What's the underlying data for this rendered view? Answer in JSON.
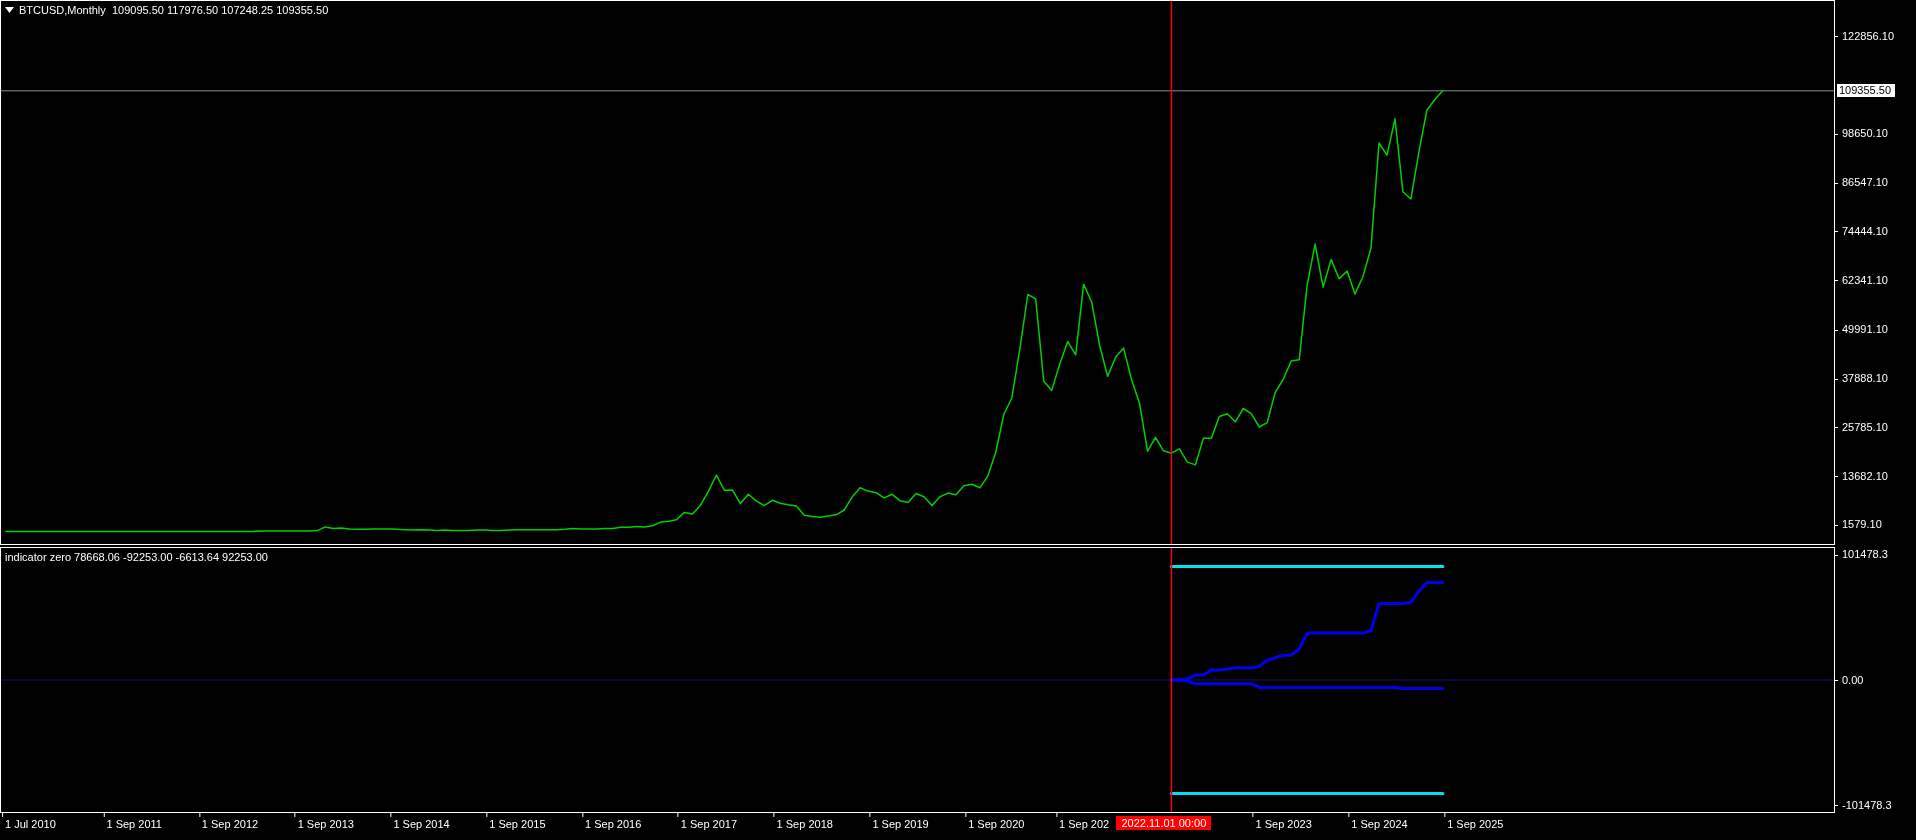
{
  "chart": {
    "title": "BTCUSD,Monthly  109095.50 117976.50 107248.25 109355.50",
    "current_price_label": "109355.50",
    "chart_data": {
      "type": "line",
      "ylim": [
        -3138,
        131645
      ],
      "categories": [
        null,
        null,
        null,
        null,
        null,
        null,
        null,
        null,
        null,
        null,
        null,
        null,
        null,
        null,
        null,
        null,
        null,
        null,
        null,
        null,
        null,
        null,
        null,
        null,
        null,
        null,
        null,
        null,
        null,
        null,
        null,
        null,
        null,
        null,
        null,
        null,
        null,
        null,
        null,
        null,
        null,
        null,
        null,
        null,
        null,
        null,
        null,
        null,
        null,
        null,
        null,
        null,
        null,
        null,
        null,
        null,
        null,
        null,
        null,
        null,
        null,
        null,
        null,
        null,
        null,
        null,
        null,
        null,
        null,
        null,
        null,
        null,
        null,
        null,
        null,
        null,
        null,
        null,
        null,
        null,
        null,
        null,
        null,
        null,
        null,
        null,
        null,
        null,
        null,
        null,
        null,
        null,
        null,
        null,
        null,
        null,
        null,
        null,
        null,
        null,
        null,
        null,
        null,
        null,
        null,
        null,
        null,
        null,
        null,
        null,
        null,
        null,
        null,
        null,
        null,
        null,
        null,
        null,
        null,
        null,
        null,
        null,
        null,
        null,
        null,
        null,
        null,
        null,
        null,
        null,
        null,
        null,
        null,
        null,
        null,
        null,
        null,
        null,
        null,
        null,
        null,
        null,
        null,
        null,
        null,
        null,
        null,
        null,
        null,
        null,
        null,
        null,
        null,
        null,
        null,
        null,
        null,
        null,
        null,
        null,
        null,
        null,
        null,
        null,
        null,
        null,
        null,
        null,
        null,
        null,
        null,
        null,
        null,
        null,
        null,
        null,
        null,
        null,
        null,
        null,
        null,
        null,
        null,
        null,
        null,
        null,
        null,
        null,
        null,
        null,
        null,
        null,
        null,
        null,
        null,
        null,
        null,
        null,
        null,
        null,
        null,
        null,
        null,
        null,
        null,
        null,
        null,
        null,
        null,
        null,
        null,
        null,
        null,
        null,
        null,
        null,
        null,
        null,
        null,
        null,
        null,
        null,
        null,
        null,
        null,
        null,
        null,
        null,
        null,
        null
      ],
      "series": [
        {
          "color": "#00d000",
          "values": [
            0,
            0,
            0,
            0,
            0,
            0,
            0,
            0,
            0,
            0,
            0,
            0,
            0,
            0,
            0,
            0,
            0,
            0,
            0,
            0,
            0,
            0,
            0,
            0,
            0,
            0,
            0,
            0,
            0,
            0,
            0,
            0,
            100,
            100,
            100,
            100,
            100,
            100,
            100,
            200,
            1100,
            700,
            800,
            600,
            500,
            500,
            600,
            600,
            600,
            500,
            400,
            300,
            400,
            300,
            200,
            300,
            200,
            200,
            200,
            300,
            300,
            200,
            200,
            300,
            400,
            400,
            400,
            400,
            400,
            400,
            500,
            700,
            600,
            600,
            600,
            700,
            700,
            1000,
            1000,
            1200,
            1100,
            1400,
            2300,
            2500,
            2900,
            4700,
            4300,
            6500,
            10000,
            14000,
            10200,
            10300,
            6900,
            9200,
            7500,
            6400,
            7700,
            7000,
            6600,
            6300,
            4000,
            3700,
            3500,
            3800,
            4100,
            5300,
            8500,
            10800,
            10000,
            9600,
            8300,
            9200,
            7600,
            7200,
            9400,
            8600,
            6400,
            8600,
            9500,
            9100,
            11300,
            11700,
            10800,
            13800,
            19700,
            29000,
            33100,
            45200,
            58800,
            57700,
            37300,
            35000,
            41500,
            47100,
            43800,
            61300,
            57000,
            46200,
            38500,
            43200,
            45500,
            37700,
            31800,
            19900,
            23300,
            20000,
            19400,
            20500,
            17200,
            16500,
            23100,
            23100,
            28500,
            29200,
            27200,
            30500,
            29200,
            25900,
            27000,
            34500,
            37700,
            42300,
            42600,
            61200,
            71300,
            60600,
            67500,
            62700,
            64600,
            58900,
            63300,
            70300,
            96400,
            93400,
            102400,
            84300,
            82500,
            94200,
            104600,
            107200,
            109400,
            null,
            null,
            null,
            null,
            null,
            null,
            null,
            null,
            null,
            null,
            null,
            null,
            null,
            null,
            null,
            null,
            null,
            null,
            null,
            null,
            null,
            null,
            null,
            null,
            null,
            null,
            null,
            null,
            null,
            null,
            null,
            null,
            null,
            null,
            null,
            null,
            null,
            null,
            null,
            null,
            null,
            null,
            null,
            null,
            null,
            null,
            null,
            null,
            null
          ]
        }
      ],
      "ref_lines": [
        {
          "axis": "y",
          "value": 109355.5
        }
      ],
      "yticks": [
        {
          "value": 122856.1,
          "label": "122856.10"
        },
        {
          "value": 98650.1,
          "label": "98650.10"
        },
        {
          "value": 86547.1,
          "label": "86547.10"
        },
        {
          "value": 74444.1,
          "label": "74444.10"
        },
        {
          "value": 62341.1,
          "label": "62341.10"
        },
        {
          "value": 49991.1,
          "label": "49991.10"
        },
        {
          "value": 37888.1,
          "label": "37888.10"
        },
        {
          "value": 25785.1,
          "label": "25785.10"
        },
        {
          "value": 13682.1,
          "label": "13682.10"
        },
        {
          "value": 1579.1,
          "label": "1579.10"
        }
      ]
    }
  },
  "indicator": {
    "title": "indicator zero 78668.06 -92253.00 -6613.64 92253.00",
    "chart_data": {
      "type": "line",
      "ylim": [
        -107000,
        107000
      ],
      "categories": [
        null,
        null,
        null,
        "1 Jul 2010",
        null,
        null,
        null,
        null,
        null,
        null,
        null,
        null,
        null,
        null,
        null,
        null,
        "1 Sep 2011",
        null,
        null,
        null,
        null,
        null,
        null,
        null,
        null,
        null,
        null,
        null,
        "1 Sep 2012",
        null,
        null,
        null,
        null,
        null,
        null,
        null,
        null,
        null,
        null,
        null,
        "1 Sep 2013",
        null,
        null,
        null,
        null,
        null,
        null,
        null,
        null,
        null,
        null,
        null,
        "1 Sep 2014",
        null,
        null,
        null,
        null,
        null,
        null,
        null,
        null,
        null,
        null,
        null,
        "1 Sep 2015",
        null,
        null,
        null,
        null,
        null,
        null,
        null,
        null,
        null,
        null,
        null,
        "1 Sep 2016",
        null,
        null,
        null,
        null,
        null,
        null,
        null,
        null,
        null,
        null,
        null,
        "1 Sep 2017",
        null,
        null,
        null,
        null,
        null,
        null,
        null,
        null,
        null,
        null,
        null,
        "1 Sep 2018",
        null,
        null,
        null,
        null,
        null,
        null,
        null,
        null,
        null,
        null,
        null,
        "1 Sep 2019",
        null,
        null,
        null,
        null,
        null,
        null,
        null,
        null,
        null,
        null,
        null,
        "1 Sep 2020",
        null,
        null,
        null,
        null,
        null,
        null,
        null,
        null,
        null,
        null,
        "1 Sep 202",
        null,
        null,
        null,
        null,
        null,
        null,
        null,
        null,
        null,
        null,
        null,
        null,
        null,
        null,
        null,
        null,
        null,
        null,
        null,
        null,
        null,
        null,
        null,
        null,
        "1 Sep 2023",
        null,
        null,
        null,
        null,
        null,
        null,
        null,
        null,
        null,
        null,
        null,
        "1 Sep 2024",
        null,
        null,
        null,
        null,
        null,
        null,
        null,
        null,
        null,
        null,
        null,
        "1 Sep 2025",
        null,
        null,
        null,
        null,
        null,
        null,
        null,
        null,
        null,
        null,
        null,
        null,
        null,
        null,
        null,
        null,
        null,
        null,
        null,
        null,
        null,
        null,
        null,
        null,
        null,
        null,
        null,
        null,
        null,
        null,
        null,
        null,
        null,
        null,
        null,
        null,
        null,
        null,
        null,
        null,
        null,
        null,
        null,
        null,
        null
      ],
      "series": [
        {
          "color": "#00e5ee",
          "values": [
            null,
            null,
            null,
            null,
            null,
            null,
            null,
            null,
            null,
            null,
            null,
            null,
            null,
            null,
            null,
            null,
            null,
            null,
            null,
            null,
            null,
            null,
            null,
            null,
            null,
            null,
            null,
            null,
            null,
            null,
            null,
            null,
            null,
            null,
            null,
            null,
            null,
            null,
            null,
            null,
            null,
            null,
            null,
            null,
            null,
            null,
            null,
            null,
            null,
            null,
            null,
            null,
            null,
            null,
            null,
            null,
            null,
            null,
            null,
            null,
            null,
            null,
            null,
            null,
            null,
            null,
            null,
            null,
            null,
            null,
            null,
            null,
            null,
            null,
            null,
            null,
            null,
            null,
            null,
            null,
            null,
            null,
            null,
            null,
            null,
            null,
            null,
            null,
            null,
            null,
            null,
            null,
            null,
            null,
            null,
            null,
            null,
            null,
            null,
            null,
            null,
            null,
            null,
            null,
            null,
            null,
            null,
            null,
            null,
            null,
            null,
            null,
            null,
            null,
            null,
            null,
            null,
            null,
            null,
            null,
            null,
            null,
            null,
            null,
            null,
            null,
            null,
            null,
            null,
            null,
            null,
            null,
            null,
            null,
            null,
            null,
            null,
            null,
            null,
            null,
            null,
            null,
            null,
            null,
            null,
            null,
            92000,
            92000,
            92000,
            92000,
            92000,
            92000,
            92000,
            92000,
            92000,
            92000,
            92000,
            92000,
            92000,
            92000,
            92000,
            92000,
            92000,
            92000,
            92000,
            92000,
            92000,
            92000,
            92000,
            92000,
            92000,
            92000,
            92000,
            92000,
            92000,
            92000,
            92000,
            92000,
            92000,
            92000,
            92000,
            null,
            null,
            null,
            null,
            null,
            null,
            null,
            null,
            null,
            null,
            null,
            null,
            null,
            null,
            null,
            null,
            null,
            null,
            null,
            null,
            null,
            null,
            null,
            null,
            null,
            null,
            null,
            null,
            null,
            null,
            null,
            null,
            null,
            null,
            null,
            null,
            null,
            null,
            null,
            null,
            null,
            null,
            null,
            null,
            null,
            null,
            null,
            null,
            null
          ]
        },
        {
          "color": "#0000ee",
          "values": [
            null,
            null,
            null,
            null,
            null,
            null,
            null,
            null,
            null,
            null,
            null,
            null,
            null,
            null,
            null,
            null,
            null,
            null,
            null,
            null,
            null,
            null,
            null,
            null,
            null,
            null,
            null,
            null,
            null,
            null,
            null,
            null,
            null,
            null,
            null,
            null,
            null,
            null,
            null,
            null,
            null,
            null,
            null,
            null,
            null,
            null,
            null,
            null,
            null,
            null,
            null,
            null,
            null,
            null,
            null,
            null,
            null,
            null,
            null,
            null,
            null,
            null,
            null,
            null,
            null,
            null,
            null,
            null,
            null,
            null,
            null,
            null,
            null,
            null,
            null,
            null,
            null,
            null,
            null,
            null,
            null,
            null,
            null,
            null,
            null,
            null,
            null,
            null,
            null,
            null,
            null,
            null,
            null,
            null,
            null,
            null,
            null,
            null,
            null,
            null,
            null,
            null,
            null,
            null,
            null,
            null,
            null,
            null,
            null,
            null,
            null,
            null,
            null,
            null,
            null,
            null,
            null,
            null,
            null,
            null,
            null,
            null,
            null,
            null,
            null,
            null,
            null,
            null,
            null,
            null,
            null,
            null,
            null,
            null,
            null,
            null,
            null,
            null,
            null,
            null,
            null,
            null,
            null,
            null,
            null,
            null,
            0,
            0,
            1000,
            4000,
            4000,
            8000,
            8000,
            9000,
            10000,
            10000,
            10000,
            11000,
            16000,
            18000,
            20000,
            20000,
            25000,
            38000,
            38000,
            38000,
            38000,
            38000,
            38000,
            38000,
            38000,
            40000,
            62000,
            62000,
            62000,
            62000,
            63000,
            72000,
            79000,
            79000,
            79000,
            null,
            null,
            null,
            null,
            null,
            null,
            null,
            null,
            null,
            null,
            null,
            null,
            null,
            null,
            null,
            null,
            null,
            null,
            null,
            null,
            null,
            null,
            null,
            null,
            null,
            null,
            null,
            null,
            null,
            null,
            null,
            null,
            null,
            null,
            null,
            null,
            null,
            null,
            null,
            null,
            null,
            null,
            null,
            null,
            null,
            null,
            null,
            null,
            null
          ]
        },
        {
          "color": "#0000e8",
          "values": [
            null,
            null,
            null,
            null,
            null,
            null,
            null,
            null,
            null,
            null,
            null,
            null,
            null,
            null,
            null,
            null,
            null,
            null,
            null,
            null,
            null,
            null,
            null,
            null,
            null,
            null,
            null,
            null,
            null,
            null,
            null,
            null,
            null,
            null,
            null,
            null,
            null,
            null,
            null,
            null,
            null,
            null,
            null,
            null,
            null,
            null,
            null,
            null,
            null,
            null,
            null,
            null,
            null,
            null,
            null,
            null,
            null,
            null,
            null,
            null,
            null,
            null,
            null,
            null,
            null,
            null,
            null,
            null,
            null,
            null,
            null,
            null,
            null,
            null,
            null,
            null,
            null,
            null,
            null,
            null,
            null,
            null,
            null,
            null,
            null,
            null,
            null,
            null,
            null,
            null,
            null,
            null,
            null,
            null,
            null,
            null,
            null,
            null,
            null,
            null,
            null,
            null,
            null,
            null,
            null,
            null,
            null,
            null,
            null,
            null,
            null,
            null,
            null,
            null,
            null,
            null,
            null,
            null,
            null,
            null,
            null,
            null,
            null,
            null,
            null,
            null,
            null,
            null,
            null,
            null,
            null,
            null,
            null,
            null,
            null,
            null,
            null,
            null,
            null,
            null,
            null,
            null,
            null,
            null,
            null,
            null,
            0,
            0,
            -1000,
            -3000,
            -3000,
            -3000,
            -3000,
            -3000,
            -3000,
            -3000,
            -3000,
            -6000,
            -6000,
            -6000,
            -6000,
            -6000,
            -6000,
            -6000,
            -6000,
            -6000,
            -6000,
            -6000,
            -6000,
            -6000,
            -6000,
            -6000,
            -6000,
            -6000,
            -6000,
            -7000,
            -7000,
            -7000,
            -7000,
            -7000,
            -7000,
            null,
            null,
            null,
            null,
            null,
            null,
            null,
            null,
            null,
            null,
            null,
            null,
            null,
            null,
            null,
            null,
            null,
            null,
            null,
            null,
            null,
            null,
            null,
            null,
            null,
            null,
            null,
            null,
            null,
            null,
            null,
            null,
            null,
            null,
            null,
            null,
            null,
            null,
            null,
            null,
            null,
            null,
            null,
            null,
            null,
            null,
            null,
            null,
            null
          ]
        },
        {
          "color": "#00e0ee",
          "values": [
            null,
            null,
            null,
            null,
            null,
            null,
            null,
            null,
            null,
            null,
            null,
            null,
            null,
            null,
            null,
            null,
            null,
            null,
            null,
            null,
            null,
            null,
            null,
            null,
            null,
            null,
            null,
            null,
            null,
            null,
            null,
            null,
            null,
            null,
            null,
            null,
            null,
            null,
            null,
            null,
            null,
            null,
            null,
            null,
            null,
            null,
            null,
            null,
            null,
            null,
            null,
            null,
            null,
            null,
            null,
            null,
            null,
            null,
            null,
            null,
            null,
            null,
            null,
            null,
            null,
            null,
            null,
            null,
            null,
            null,
            null,
            null,
            null,
            null,
            null,
            null,
            null,
            null,
            null,
            null,
            null,
            null,
            null,
            null,
            null,
            null,
            null,
            null,
            null,
            null,
            null,
            null,
            null,
            null,
            null,
            null,
            null,
            null,
            null,
            null,
            null,
            null,
            null,
            null,
            null,
            null,
            null,
            null,
            null,
            null,
            null,
            null,
            null,
            null,
            null,
            null,
            null,
            null,
            null,
            null,
            null,
            null,
            null,
            null,
            null,
            null,
            null,
            null,
            null,
            null,
            null,
            null,
            null,
            null,
            null,
            null,
            null,
            null,
            null,
            null,
            null,
            null,
            null,
            null,
            null,
            null,
            -92000,
            -92000,
            -92000,
            -92000,
            -92000,
            -92000,
            -92000,
            -92000,
            -92000,
            -92000,
            -92000,
            -92000,
            -92000,
            -92000,
            -92000,
            -92000,
            -92000,
            -92000,
            -92000,
            -92000,
            -92000,
            -92000,
            -92000,
            -92000,
            -92000,
            -92000,
            -92000,
            -92000,
            -92000,
            -92000,
            -92000,
            -92000,
            -92000,
            -92000,
            -92000,
            null,
            null,
            null,
            null,
            null,
            null,
            null,
            null,
            null,
            null,
            null,
            null,
            null,
            null,
            null,
            null,
            null,
            null,
            null,
            null,
            null,
            null,
            null,
            null,
            null,
            null,
            null,
            null,
            null,
            null,
            null,
            null,
            null,
            null,
            null,
            null,
            null,
            null,
            null,
            null,
            null,
            null,
            null,
            null,
            null,
            null,
            null,
            null,
            null
          ]
        }
      ],
      "ref_lines": [
        {
          "axis": "y",
          "value": 0
        }
      ],
      "yticks": [
        {
          "value": 101478.3,
          "label": "101478.3"
        },
        {
          "value": 0,
          "label": "0.00"
        },
        {
          "value": -101478.3,
          "label": "-101478.3"
        }
      ]
    }
  },
  "crosshair": {
    "label": "2022.11.01 00:00"
  }
}
